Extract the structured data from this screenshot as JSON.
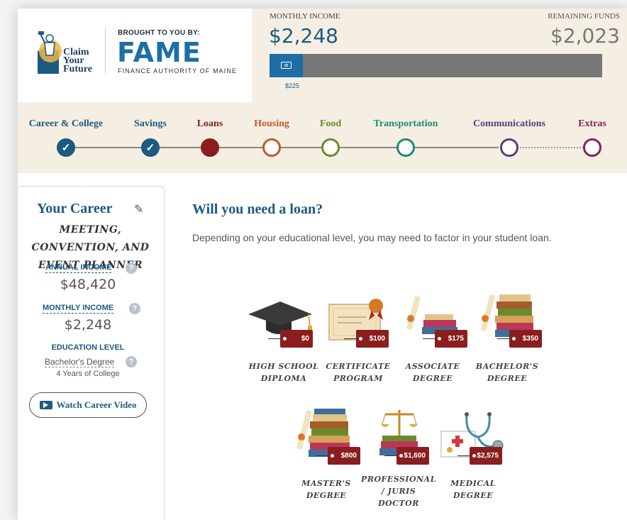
{
  "header": {
    "claim_logo": "Claim Your Future",
    "brought_by": "BROUGHT TO YOU BY:",
    "fame_logo": "FAME",
    "fame_subtitle": "FINANCE AUTHORITY OF MAINE",
    "monthly_income_label": "MONTHLY INCOME",
    "monthly_income_value": "$2,248",
    "remaining_label": "REMAINING FUNDS",
    "remaining_value": "$2,023",
    "budget_spent_label": "$225",
    "budget_spent_fraction": 0.1,
    "budget_icon": "money-icon"
  },
  "steps": [
    {
      "label": "Career & College",
      "state": "done",
      "color": "#1c5a80"
    },
    {
      "label": "Savings",
      "state": "done",
      "color": "#1c5a80"
    },
    {
      "label": "Loans",
      "state": "current",
      "color": "#8a1e1e"
    },
    {
      "label": "Housing",
      "state": "upcoming",
      "color": "#c1592a"
    },
    {
      "label": "Food",
      "state": "upcoming",
      "color": "#6b8a2c"
    },
    {
      "label": "Transportation",
      "state": "upcoming",
      "color": "#1e8a73"
    },
    {
      "label": "Communications",
      "state": "upcoming",
      "color": "#5b3d7a"
    },
    {
      "label": "Extras",
      "state": "upcoming",
      "color": "#8a1e5c"
    }
  ],
  "sidebar": {
    "title": "Your Career",
    "edit_icon": "pencil-icon",
    "career_name": "Meeting, Convention, and Event Planner",
    "annual_income_label": "ANNUAL INCOME",
    "annual_income_value": "$48,420",
    "monthly_income_label": "MONTHLY INCOME",
    "monthly_income_value": "$2,248",
    "education_label": "EDUCATION LEVEL",
    "education_value": "Bachelor's Degree",
    "education_years": "4 Years of College",
    "help_glyph": "?",
    "video_button": "Watch Career Video"
  },
  "main": {
    "title": "Will you need a loan?",
    "description": "Depending on your educational level, you may need to factor in your student loan."
  },
  "loan_options": [
    {
      "label": "High School Diploma",
      "price": "$0",
      "art": "graduation-cap-icon"
    },
    {
      "label": "Certificate Program",
      "price": "$100",
      "art": "certificate-icon"
    },
    {
      "label": "Associate Degree",
      "price": "$175",
      "art": "diploma-books-icon"
    },
    {
      "label": "Bachelor's Degree",
      "price": "$350",
      "art": "diploma-books-icon"
    },
    {
      "label": "Master's Degree",
      "price": "$800",
      "art": "diploma-books-icon"
    },
    {
      "label": "Professional / Juris Doctor",
      "price": "$1,600",
      "art": "scales-books-icon"
    },
    {
      "label": "Medical Degree",
      "price": "$2,575",
      "art": "stethoscope-icon"
    }
  ]
}
